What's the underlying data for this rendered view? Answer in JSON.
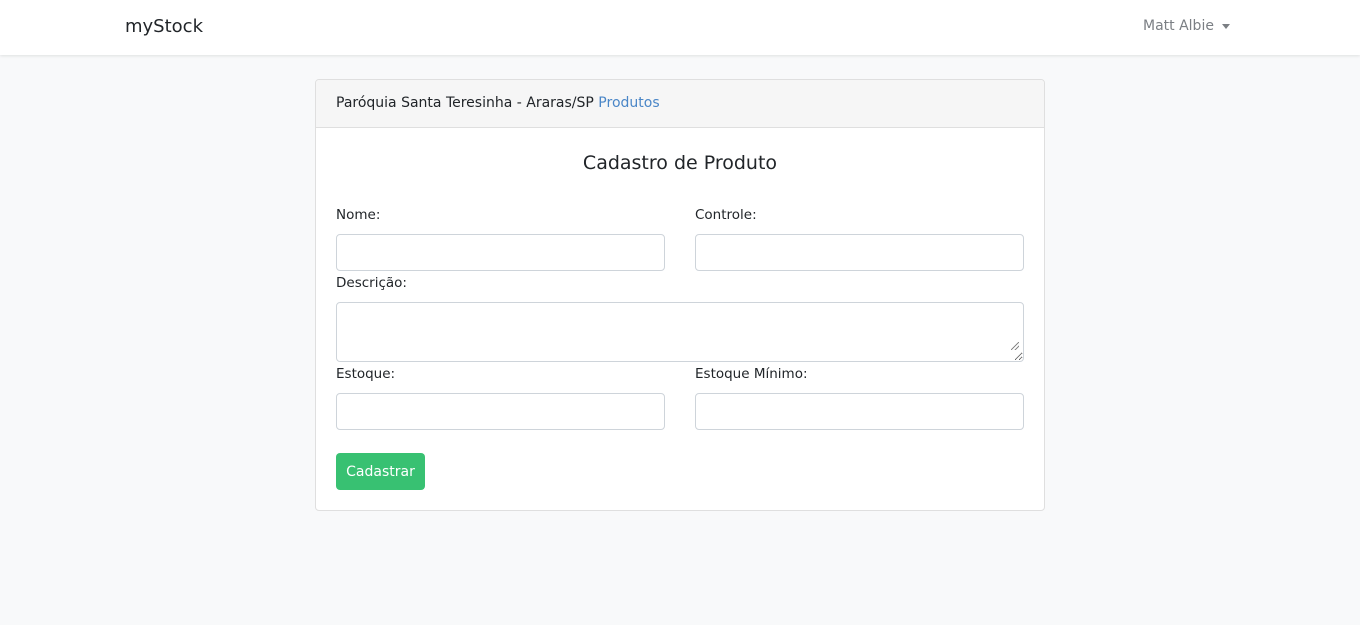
{
  "navbar": {
    "brand": "myStock",
    "user_name": "Matt Albie"
  },
  "card": {
    "header": {
      "org": "Paróquia Santa Teresinha - Araras/SP",
      "link": "Produtos"
    },
    "title": "Cadastro de Produto",
    "fields": {
      "nome": {
        "label": "Nome:",
        "value": ""
      },
      "controle": {
        "label": "Controle:",
        "value": ""
      },
      "descricao": {
        "label": "Descrição:",
        "value": ""
      },
      "estoque": {
        "label": "Estoque:",
        "value": ""
      },
      "estoque_minimo": {
        "label": "Estoque Mínimo:",
        "value": ""
      }
    },
    "submit_label": "Cadastrar"
  },
  "colors": {
    "page_bg": "#f8f9fa",
    "link": "#4a86c7",
    "submit": "#38c172",
    "muted": "#7b7f84"
  }
}
